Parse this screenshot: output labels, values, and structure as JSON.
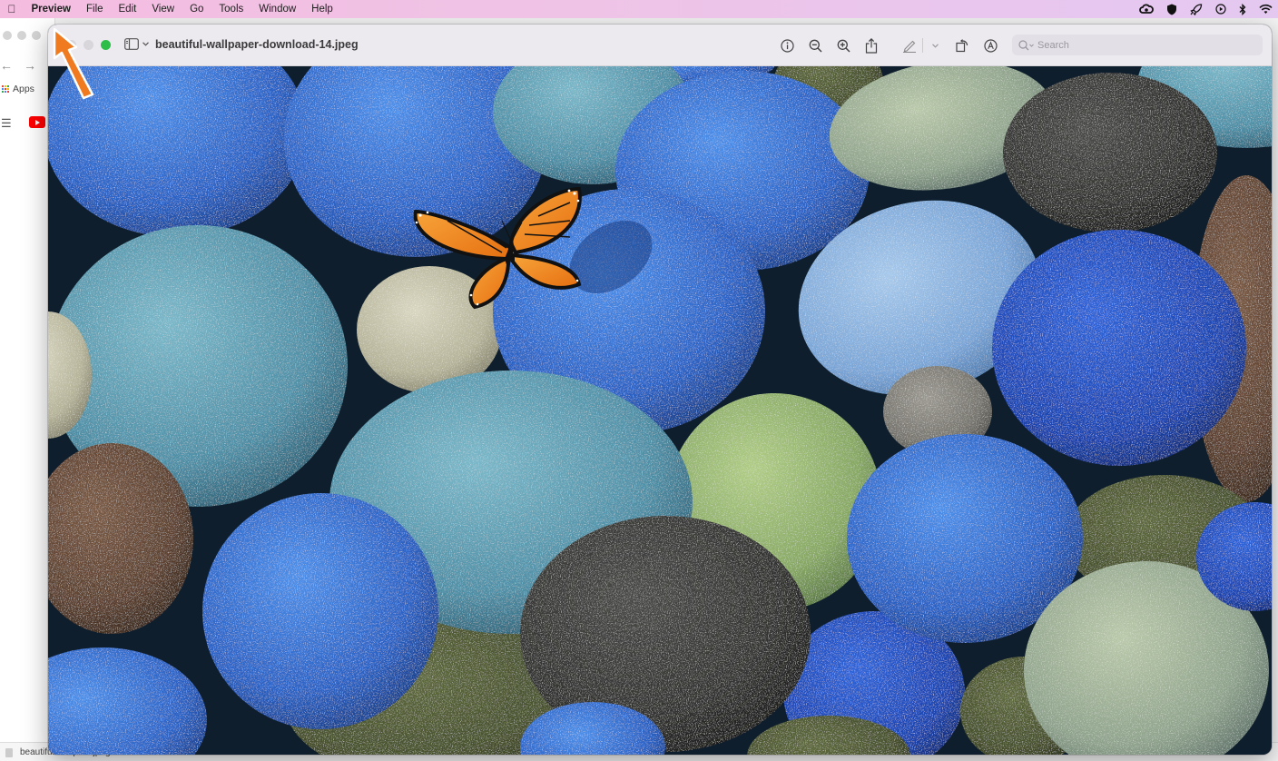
{
  "menubar": {
    "app_name": "Preview",
    "items": [
      "File",
      "Edit",
      "View",
      "Go",
      "Tools",
      "Window",
      "Help"
    ],
    "status_icons": [
      "creative-cloud-icon",
      "shield-icon",
      "rocket-icon",
      "play-circle-icon",
      "bluetooth-icon",
      "wifi-icon"
    ]
  },
  "background_browser": {
    "bookmark_apps": "Apps",
    "download_file": "beautiful-wallpa....jpeg"
  },
  "preview_window": {
    "title": "beautiful-wallpaper-download-14.jpeg",
    "toolbar_icons": [
      "info-icon",
      "zoom-out-icon",
      "zoom-in-icon",
      "share-icon",
      "markup-pen-icon",
      "rotate-icon",
      "annotate-icon"
    ],
    "search_placeholder": "Search"
  },
  "colors": {
    "annotation_arrow": "#f07a1f",
    "close": "#d8d6da",
    "minimize": "#d8d6da",
    "zoom": "#2fbd4a",
    "blue_stone": "#2f6fd0",
    "teal_stone": "#5a9ab0",
    "butterfly": "#f08c1c"
  }
}
